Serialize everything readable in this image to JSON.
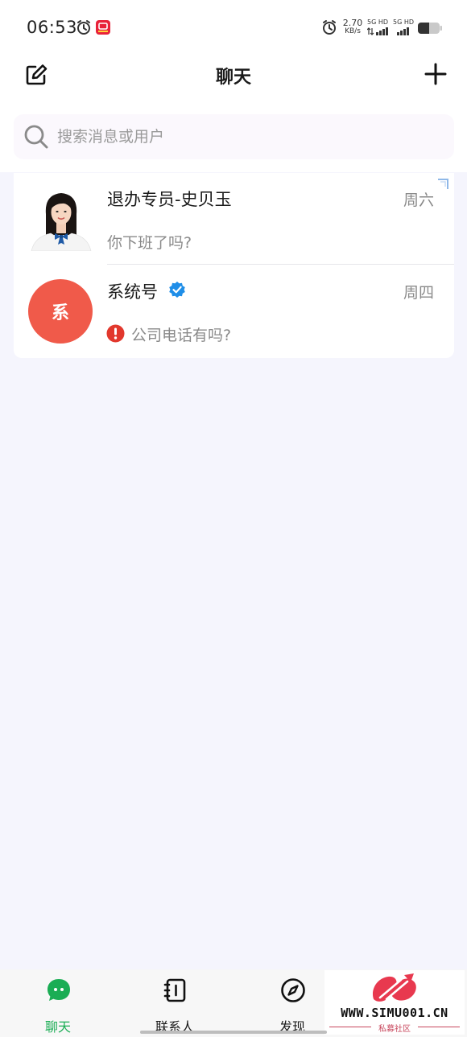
{
  "status_bar": {
    "time": "06:53",
    "net_speed": "2.70",
    "net_unit": "KB/s",
    "sim1_label": "5G HD",
    "sim2_label": "5G HD",
    "icons": [
      "alarm-icon",
      "app-notification-icon",
      "alarm-icon",
      "signal-icon",
      "signal-icon",
      "battery-icon"
    ]
  },
  "header": {
    "title": "聊天",
    "left_icon": "compose-icon",
    "right_icon": "plus-icon"
  },
  "search": {
    "placeholder": "搜索消息或用户",
    "icon": "search-icon"
  },
  "chats": [
    {
      "name": "退办专员-史贝玉",
      "time": "周六",
      "preview": "你下班了吗?",
      "avatar": "photo"
    },
    {
      "name": "系统号",
      "time": "周四",
      "preview": "公司电话有吗?",
      "avatar_text": "系",
      "avatar_color": "#f05a4a",
      "verified": true,
      "warning": true
    }
  ],
  "bottom_nav": {
    "items": [
      {
        "label": "聊天",
        "icon": "chat-bubble-icon",
        "active": true
      },
      {
        "label": "联系人",
        "icon": "contacts-book-icon",
        "active": false
      },
      {
        "label": "发现",
        "icon": "compass-icon",
        "active": false
      }
    ]
  },
  "watermark": {
    "url": "WWW.SIMU001.CN",
    "subtitle": "私募社区"
  },
  "colors": {
    "accent_green": "#1aad54",
    "avatar_red": "#f05a4a",
    "verified_blue": "#1f8ee8",
    "warning_red": "#e2382d",
    "background": "#f5f5fd"
  }
}
